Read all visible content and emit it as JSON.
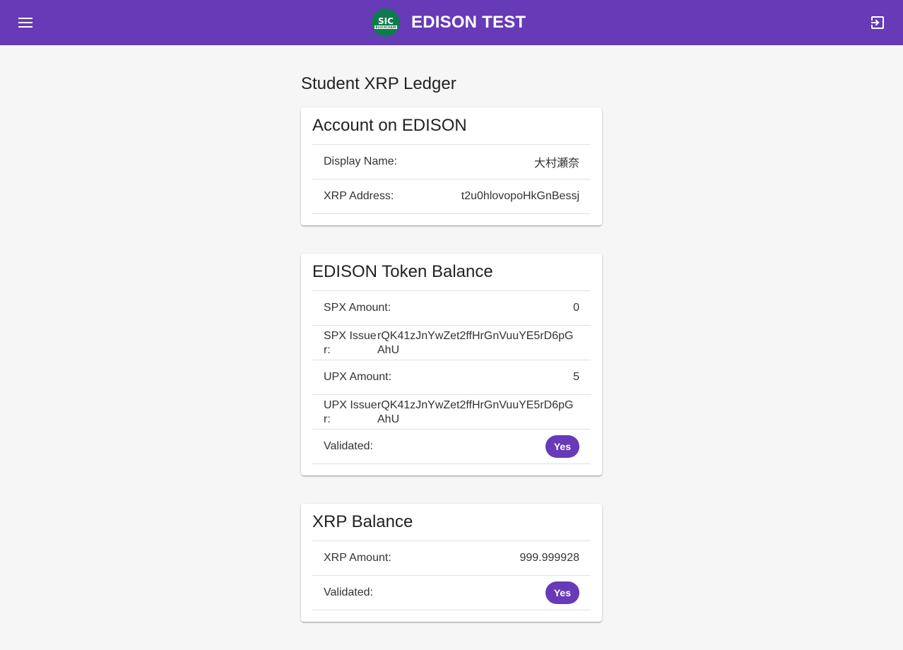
{
  "header": {
    "title": "EDISON TEST",
    "logo_text": "SIC",
    "logo_subtext": "BLOCKCHAIN",
    "menu_icon": "menu-icon",
    "logout_icon": "logout-icon",
    "bar_color": "#673ab7"
  },
  "page": {
    "title": "Student XRP Ledger"
  },
  "account_card": {
    "title": "Account on EDISON",
    "display_name_label": "Display Name:",
    "display_name_value": "大村瀬奈",
    "xrp_address_label": "XRP Address:",
    "xrp_address_value": "t2u0hlovopoHkGnBessj"
  },
  "token_card": {
    "title": "EDISON Token Balance",
    "spx_amount_label": "SPX Amount:",
    "spx_amount_value": "0",
    "spx_issuer_label": "SPX Issuer:",
    "spx_issuer_value": "rQK41zJnYwZet2ffHrGnVuuYE5rD6pGAhU",
    "upx_amount_label": "UPX Amount:",
    "upx_amount_value": "5",
    "upx_issuer_label": "UPX Issuer:",
    "upx_issuer_value": "rQK41zJnYwZet2ffHrGnVuuYE5rD6pGAhU",
    "validated_label": "Validated:",
    "validated_value": "Yes"
  },
  "xrp_card": {
    "title": "XRP Balance",
    "xrp_amount_label": "XRP Amount:",
    "xrp_amount_value": "999.999928",
    "validated_label": "Validated:",
    "validated_value": "Yes"
  }
}
